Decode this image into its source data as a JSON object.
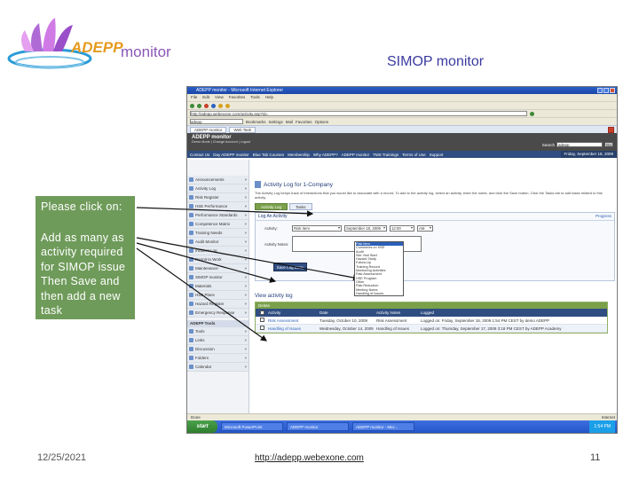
{
  "slide": {
    "logo_text": "ADEPP",
    "brand_suffix": "monitor",
    "title": "SIMOP monitor",
    "callout_line1": "Please click on:",
    "callout_line2": "Add as many as activity required for SIMOP issue Then Save and then add a new task",
    "footer_date": "12/25/2021",
    "footer_url": "http://adepp.webexone.com",
    "footer_page": "11"
  },
  "browser": {
    "window_title": "ADEPP monitor - Microsoft Internet Explorer",
    "menu": [
      "File",
      "Edit",
      "View",
      "Favorites",
      "Tools",
      "Help"
    ],
    "address": "http://adepp.webexone.com/activity.asp?id=",
    "search_value": "adepp",
    "toolbar_buttons": [
      "Bookmarks",
      "Settings",
      "Mail",
      "Favorites",
      "Options"
    ],
    "tabs": [
      "ADEPP monitor",
      "Web Task"
    ]
  },
  "app": {
    "title": "ADEPP monitor",
    "subtitle": "Demo Mode  |  Change Account  |  Logout",
    "search_label": "Search",
    "search_value": "adepp",
    "search_go": "Go",
    "nav": [
      "Contact Us",
      "Day ADEPP monitor",
      "Blue Tab Courses",
      "Membership",
      "Why ADEPP?",
      "ADEPP monitor",
      "TMS Trainings",
      "Terms of Use",
      "Support"
    ],
    "date": "Friday, September 18, 2009"
  },
  "sidebar": {
    "items": [
      "Announcements",
      "Activity Log",
      "Risk Register",
      "HSE Performance",
      "Performance Standards",
      "Competence Matrix",
      "Training Needs",
      "Audit Monitor",
      "Incident Log",
      "Permit to Work",
      "Maintenance",
      "SIMOP monitor",
      "Materials",
      "HSE Plans",
      "Hazard Register",
      "Emergency Response"
    ],
    "section_label": "ADEPP Tools",
    "tools": [
      "Tools",
      "Links",
      "Discussion",
      "Folders",
      "Calendar"
    ]
  },
  "activity": {
    "page_title": "Activity Log for 1-Company",
    "description": "The Activity Log keeps track of interactions that you would like to associate with a record. To add to the activity log, select an activity, enter the notes, and click the Save button. Click the Tasks tab to add tasks related to this activity.",
    "tab_log": "Activity Log",
    "tab_tasks": "Tasks",
    "box_title": "Log An Activity",
    "progress_label": "Progress",
    "activity_label": "Activity:",
    "activity_value": "Risk Item",
    "date_value": "September 18, 2009",
    "time_value": "12:00",
    "ampm_value": "AM",
    "notes_label": "Activity Notes:",
    "save_label": "Save Log Entry",
    "dropdown_options": [
      "Risk Item",
      "Comments on HSE",
      "Audit",
      "Site Visit Start",
      "Hazard Study",
      "Follow-Up",
      "Training Record",
      "Monitoring Activities",
      "Risk Assessment",
      "HSE Program",
      "Other",
      "Risk Reduction",
      "Meeting Notes",
      "Handling of Issues"
    ],
    "view_label": "View activity log",
    "table_caption": "Delete",
    "columns": [
      "Activity",
      "Date",
      "Activity Notes",
      "Logged"
    ],
    "rows": [
      [
        "Risk Assessment",
        "Tuesday, October 10, 2009",
        "Risk Assessment",
        "Logged on: Friday, September 18, 2009 1:54 PM CEST by demo ADEPP"
      ],
      [
        "Handling of Issues",
        "Wednesday, October 14, 2009",
        "Handling of Issues",
        "Logged on: Thursday, September 17, 2009 3:18 PM CEST by ADEPP Academy"
      ]
    ]
  },
  "status": {
    "left": "Done",
    "zone": "Internet",
    "start": "start",
    "tasks": [
      "Microsoft PowerPoint",
      "ADEPP monitor",
      "ADEPP monitor - Micr..."
    ],
    "clock": "1:54 PM"
  }
}
